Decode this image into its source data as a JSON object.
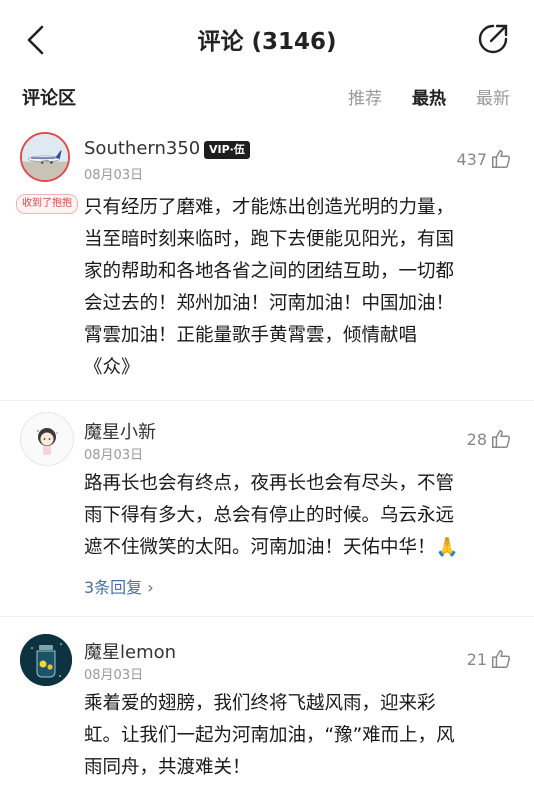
{
  "header": {
    "title": "评论 (3146)",
    "back_icon": "chevron-left-icon",
    "share_icon": "share-arrow-icon"
  },
  "section": {
    "title": "评论区",
    "sort_options": [
      "推荐",
      "最热",
      "最新"
    ],
    "active_sort": "最热"
  },
  "comments": [
    {
      "username": "Southern350",
      "vip_badge": "VIP·伍",
      "gift_badge": "收到了抱抱",
      "date": "08月03日",
      "likes": "437",
      "lines": [
        "只有经历了磨难，才能炼出创造光明的力量，",
        "当至暗时刻来临时，跑下去便能见阳光，有国",
        "家的帮助和各地各省之间的团结互助，一切都",
        "会过去的！郑州加油！河南加油！中国加油！",
        "霄雲加油！正能量歌手黄霄雲，倾情献唱",
        "《众》"
      ]
    },
    {
      "username": "魔星小新",
      "date": "08月03日",
      "likes": "28",
      "lines": [
        "路再长也会有终点，夜再长也会有尽头，不管",
        "雨下得有多大，总会有停止的时候。乌云永远",
        "遮不住微笑的太阳。河南加油！天佑中华！🙏"
      ],
      "replies": "3条回复 ›"
    },
    {
      "username": "魔星lemon",
      "date": "08月03日",
      "likes": "21",
      "lines": [
        "乘着爱的翅膀，我们终将飞越风雨，迎来彩",
        "虹。让我们一起为河南加油，“豫”难而上，风",
        "雨同舟，共渡难关！"
      ]
    }
  ],
  "colors": {
    "accent_red": "#e24a4a",
    "link_blue": "#4a6fa5",
    "muted": "#999999"
  }
}
